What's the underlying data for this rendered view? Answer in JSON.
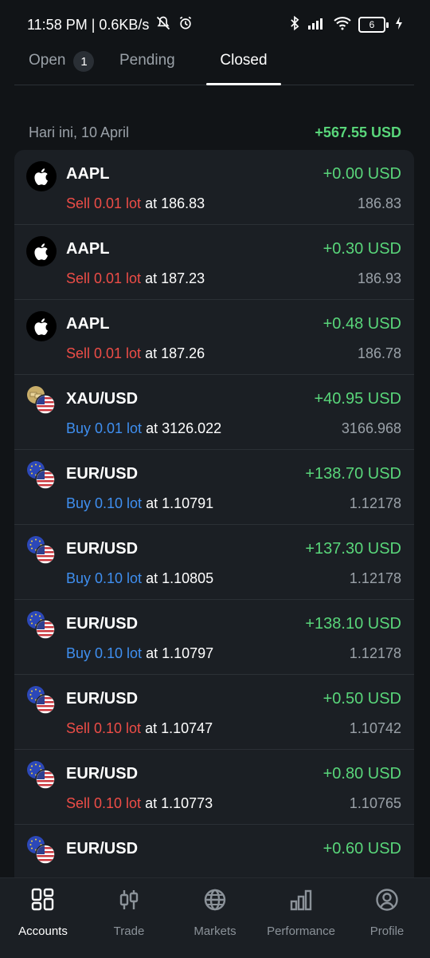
{
  "status": {
    "time_speed": "11:58 PM | 0.6KB/s",
    "battery": "6"
  },
  "tabs": {
    "open_label": "Open",
    "open_count": "1",
    "pending_label": "Pending",
    "closed_label": "Closed"
  },
  "section": {
    "date": "Hari ini, 10 April",
    "total": "+567.55 USD"
  },
  "trades": [
    {
      "symbol": "AAPL",
      "pnl": "+0.00 USD",
      "side": "Sell 0.01 lot",
      "at": " at 186.83",
      "close": "186.83",
      "icon": "apple-icon"
    },
    {
      "symbol": "AAPL",
      "pnl": "+0.30 USD",
      "side": "Sell 0.01 lot",
      "at": " at 187.23",
      "close": "186.93",
      "icon": "apple-icon"
    },
    {
      "symbol": "AAPL",
      "pnl": "+0.48 USD",
      "side": "Sell 0.01 lot",
      "at": " at 187.26",
      "close": "186.78",
      "icon": "apple-icon"
    },
    {
      "symbol": "XAU/USD",
      "pnl": "+40.95 USD",
      "side": "Buy 0.01 lot",
      "at": " at 3126.022",
      "close": "3166.968",
      "icon": "gold-usd-flag-icon"
    },
    {
      "symbol": "EUR/USD",
      "pnl": "+138.70 USD",
      "side": "Buy 0.10 lot",
      "at": " at 1.10791",
      "close": "1.12178",
      "icon": "eur-usd-flag-icon"
    },
    {
      "symbol": "EUR/USD",
      "pnl": "+137.30 USD",
      "side": "Buy 0.10 lot",
      "at": " at 1.10805",
      "close": "1.12178",
      "icon": "eur-usd-flag-icon"
    },
    {
      "symbol": "EUR/USD",
      "pnl": "+138.10 USD",
      "side": "Buy 0.10 lot",
      "at": " at 1.10797",
      "close": "1.12178",
      "icon": "eur-usd-flag-icon"
    },
    {
      "symbol": "EUR/USD",
      "pnl": "+0.50 USD",
      "side": "Sell 0.10 lot",
      "at": " at 1.10747",
      "close": "1.10742",
      "icon": "eur-usd-flag-icon"
    },
    {
      "symbol": "EUR/USD",
      "pnl": "+0.80 USD",
      "side": "Sell 0.10 lot",
      "at": " at 1.10773",
      "close": "1.10765",
      "icon": "eur-usd-flag-icon"
    },
    {
      "symbol": "EUR/USD",
      "pnl": "+0.60 USD",
      "side": "",
      "at": "",
      "close": "",
      "icon": "eur-usd-flag-icon"
    }
  ],
  "nav": {
    "accounts": "Accounts",
    "trade": "Trade",
    "markets": "Markets",
    "performance": "Performance",
    "profile": "Profile"
  },
  "colors": {
    "positive": "#59d67a",
    "sell": "#ee4d47",
    "buy": "#3f8ff0",
    "background": "#111417",
    "card": "#1b1f24"
  }
}
